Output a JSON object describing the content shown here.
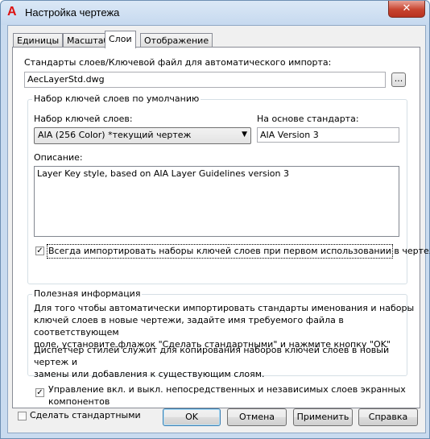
{
  "window": {
    "title": "Настройка чертежа",
    "app_icon": "A",
    "close_glyph": "✕"
  },
  "tabs": [
    {
      "label": "Единицы"
    },
    {
      "label": "Масштаб"
    },
    {
      "label": "Слои",
      "active": true
    },
    {
      "label": "Отображение"
    }
  ],
  "layers": {
    "standards_label": "Стандарты слоев/Ключевой файл для автоматического импорта:",
    "standards_file": "AecLayerStd.dwg",
    "browse_label": "...",
    "default_group_title": "Набор ключей слоев по умолчанию",
    "key_set_label": "Набор ключей слоев:",
    "key_set_value": "AIA (256 Color) *текущий чертеж",
    "based_on_label": "На основе стандарта:",
    "based_on_value": "AIA Version 3",
    "description_label": "Описание:",
    "description_value": "Layer Key style, based on AIA Layer Guidelines version 3",
    "always_import_label": "Всегда импортировать наборы ключей слоев при первом использовании в чертеже",
    "always_import_checked": true,
    "info_group_title": "Полезная информация",
    "info_paragraph_1": [
      "Для того чтобы автоматически импортировать стандарты именования и наборы",
      "ключей слоев в новые чертежи, задайте имя требуемого файла в соответствующем",
      "поле, установите флажок \"Сделать стандартными\" и нажмите кнопку \"OK\""
    ],
    "info_paragraph_2": [
      "Диспетчер стилей служит для копирования наборов ключей слоев в новый чертеж и",
      "замены или добавления к существующим слоям."
    ],
    "manage_layers_label_line1": "Управление вкл. и выкл. непосредственных и независимых слоев экранных",
    "manage_layers_label_line2": "компонентов",
    "manage_layers_checked": true
  },
  "footer": {
    "make_default_label": "Сделать стандартными",
    "make_default_checked": false,
    "ok": "OK",
    "cancel": "Отмена",
    "apply": "Применить",
    "help": "Справка"
  },
  "colors": {
    "title_bg": "#c9dbef",
    "close_red": "#c7442f",
    "accent_border": "#3c7fb1"
  }
}
